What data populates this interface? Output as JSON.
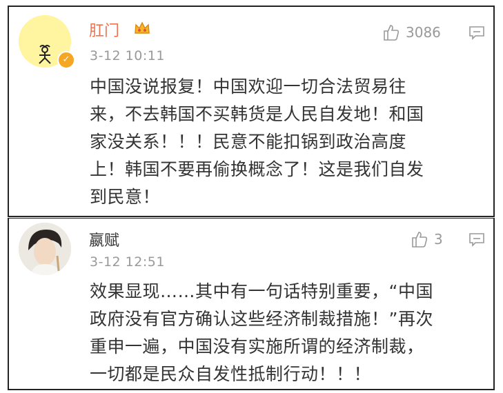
{
  "comments": [
    {
      "username": "肛门",
      "badge_icon": "crown-emoji-icon",
      "verified_icon": "verified-v-icon",
      "time": "3-12 10:11",
      "likes": "3086",
      "text_lines": [
        "中国没说报复！中国欢迎一切合法贸易往",
        "来，不去韩国不买韩货是人民自发地！和国",
        "家没关系！！！民意不能扣锅到政治高度",
        "上！韩国不要再偷换概念了！这是我们自发",
        "到民意！"
      ]
    },
    {
      "username": "嬴赋",
      "time": "3-12 12:51",
      "likes": "3",
      "text_lines": [
        "效果显现……其中有一句话特别重要，“中国",
        "政府没有官方确认这些经济制裁措施！”再次",
        "重申一遍，中国没有实施所谓的经济制裁，",
        "一切都是民众自发性抵制行动！！！"
      ]
    }
  ],
  "colors": {
    "username1": "#eb7350",
    "username2": "#333333",
    "muted": "#999999",
    "verified": "#f5a623"
  }
}
